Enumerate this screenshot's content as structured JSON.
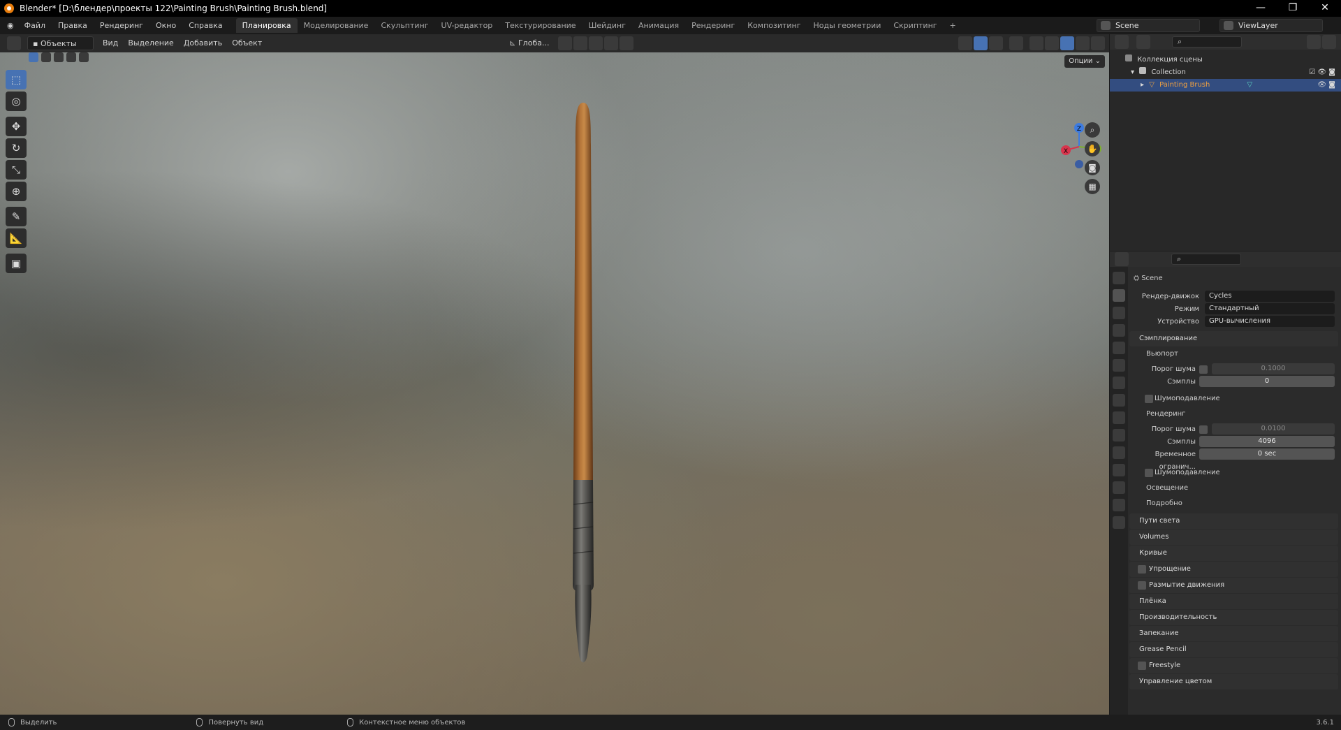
{
  "window": {
    "title": "Blender* [D:\\блендер\\проекты 122\\Painting Brush\\Painting Brush.blend]",
    "controls": [
      "—",
      "❐",
      "✕"
    ]
  },
  "menu": [
    "Файл",
    "Правка",
    "Рендеринг",
    "Окно",
    "Справка"
  ],
  "workspaces": [
    "Планировка",
    "Моделирование",
    "Скульптинг",
    "UV-редактор",
    "Текстурирование",
    "Шейдинг",
    "Анимация",
    "Рендеринг",
    "Композитинг",
    "Ноды геометрии",
    "Скриптинг",
    "+"
  ],
  "active_workspace": "Планировка",
  "scene_name": "Scene",
  "view_layer": "ViewLayer",
  "viewport_header": {
    "mode": "Объекты",
    "menus": [
      "Вид",
      "Выделение",
      "Добавить",
      "Объект"
    ],
    "transform": "Глоба..."
  },
  "viewport": {
    "options": "Опции"
  },
  "gizmo": {
    "x": "X",
    "y": "Y",
    "z": "Z"
  },
  "outliner": {
    "root": "Коллекция сцены",
    "collection": "Collection",
    "object": "Painting Brush"
  },
  "props": {
    "scene": "Scene",
    "engine_label": "Рендер-движок",
    "engine": "Cycles",
    "mode_label": "Режим",
    "mode": "Стандартный",
    "device_label": "Устройство",
    "device": "GPU-вычисления",
    "sampling": "Сэмплирование",
    "viewport": "Вьюпорт",
    "noise_label": "Порог шума",
    "vp_noise": "0.1000",
    "samples_label": "Сэмплы",
    "vp_samples": "0",
    "denoise": "Шумоподавление",
    "render": "Рендеринг",
    "r_noise": "0.0100",
    "r_samples": "4096",
    "time_label": "Временное огранич...",
    "time": "0 sec",
    "lights": "Освещение",
    "advanced": "Подробно",
    "sections": [
      "Пути света",
      "Volumes",
      "Кривые",
      "Упрощение",
      "Размытие движения",
      "Плёнка",
      "Производительность",
      "Запекание",
      "Grease Pencil",
      "Freestyle",
      "Управление цветом"
    ]
  },
  "status": {
    "select": "Выделить",
    "rotate": "Повернуть вид",
    "context": "Контекстное меню объектов",
    "version": "3.6.1"
  }
}
